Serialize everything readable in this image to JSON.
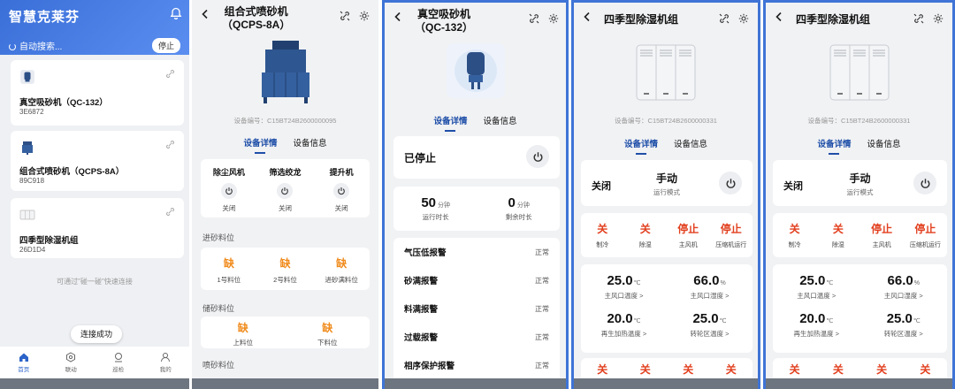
{
  "home": {
    "app_title": "智慧克莱芬",
    "searching": "自动搜索...",
    "stop": "停止",
    "devices": [
      {
        "name": "真空吸砂机（QC-132）",
        "id": "3E6872"
      },
      {
        "name": "组合式喷砂机（QCPS-8A）",
        "id": "89C918"
      },
      {
        "name": "四季型除湿机组",
        "id": "26D1D4"
      }
    ],
    "hint": "可通过\"碰一碰\"快速连接",
    "connect_success": "连接成功",
    "tabs": [
      "首页",
      "联动",
      "巡检",
      "我的"
    ]
  },
  "sandblaster": {
    "title_line1": "组合式喷砂机",
    "title_line2": "（QCPS-8A）",
    "serial": "设备编号：C15BT24B2600000095",
    "tab_detail": "设备详情",
    "tab_info": "设备信息",
    "switches": [
      {
        "name": "除尘风机",
        "state": "关闭"
      },
      {
        "name": "筛选绞龙",
        "state": "关闭"
      },
      {
        "name": "提升机",
        "state": "关闭"
      }
    ],
    "feed_title": "进砂料位",
    "feed": [
      {
        "value": "缺",
        "label": "1号料位"
      },
      {
        "value": "缺",
        "label": "2号料位"
      },
      {
        "value": "缺",
        "label": "进砂满料位"
      }
    ],
    "store_title": "储砂料位",
    "store": [
      {
        "value": "缺",
        "label": "上料位"
      },
      {
        "value": "缺",
        "label": "下料位"
      }
    ],
    "blast_title": "喷砂料位"
  },
  "vacuum": {
    "title_line1": "真空吸砂机",
    "title_line2": "（QC-132）",
    "tab_detail": "设备详情",
    "tab_info": "设备信息",
    "status": "已停止",
    "run_value": "50",
    "run_unit": "分钟",
    "run_label": "运行时长",
    "remain_value": "0",
    "remain_unit": "分钟",
    "remain_label": "剩余时长",
    "alarms": [
      {
        "name": "气压低报警",
        "state": "正常"
      },
      {
        "name": "砂满报警",
        "state": "正常"
      },
      {
        "name": "料满报警",
        "state": "正常"
      },
      {
        "name": "过载报警",
        "state": "正常"
      },
      {
        "name": "相序保护报警",
        "state": "正常"
      }
    ]
  },
  "dehum_a": {
    "title": "四季型除湿机组",
    "serial": "设备编号：C15BT24B2600000331",
    "tab_detail": "设备详情",
    "tab_info": "设备信息",
    "power": "关闭",
    "mode_value": "手动",
    "mode_label": "运行模式",
    "states": [
      {
        "value": "关",
        "label": "制冷"
      },
      {
        "value": "关",
        "label": "除湿"
      },
      {
        "value": "停止",
        "label": "主风机"
      },
      {
        "value": "停止",
        "label": "压缩机运行"
      }
    ],
    "readings": [
      {
        "value": "25.0",
        "unit": "℃",
        "label": "主风口温度 >"
      },
      {
        "value": "66.0",
        "unit": "%",
        "label": "主风口湿度 >"
      },
      {
        "value": "20.0",
        "unit": "℃",
        "label": "再生加热温度 >"
      },
      {
        "value": "25.0",
        "unit": "℃",
        "label": "转轮区温度 >"
      }
    ],
    "bottom_states": [
      "关",
      "关",
      "关",
      "关"
    ]
  },
  "dehum_b": {
    "title": "四季型除湿机组",
    "serial": "设备编号：C15BT24B2600000331",
    "tab_detail": "设备详情",
    "tab_info": "设备信息",
    "power": "关闭",
    "mode_value": "手动",
    "mode_label": "运行模式",
    "states": [
      {
        "value": "关",
        "label": "制冷"
      },
      {
        "value": "关",
        "label": "除湿"
      },
      {
        "value": "停止",
        "label": "主风机"
      },
      {
        "value": "停止",
        "label": "压缩机运行"
      }
    ],
    "readings": [
      {
        "value": "25.0",
        "unit": "℃",
        "label": "主风口温度 >"
      },
      {
        "value": "66.0",
        "unit": "%",
        "label": "主风口湿度 >"
      },
      {
        "value": "20.0",
        "unit": "℃",
        "label": "再生加热温度 >"
      },
      {
        "value": "25.0",
        "unit": "℃",
        "label": "转轮区温度 >"
      }
    ],
    "bottom_states": [
      "关",
      "关",
      "关",
      "关"
    ]
  }
}
